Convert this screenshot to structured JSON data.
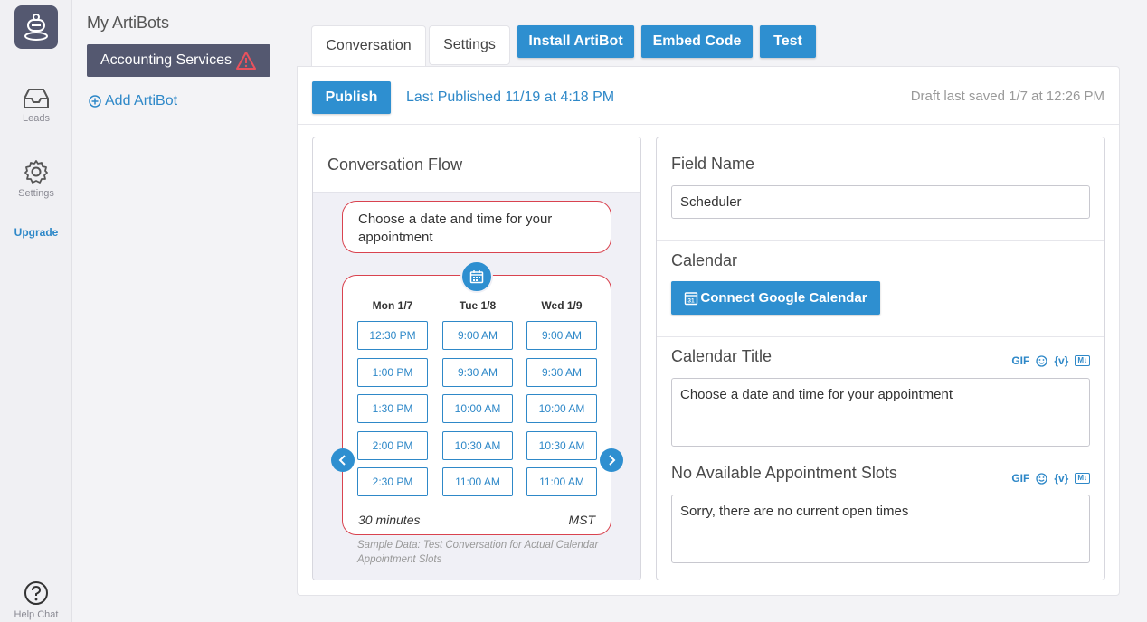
{
  "rail": {
    "leads_label": "Leads",
    "settings_label": "Settings",
    "upgrade_label": "Upgrade",
    "help_label": "Help Chat"
  },
  "bots": {
    "title": "My ArtiBots",
    "selected_bot": "Accounting Services",
    "add_label": "Add ArtiBot"
  },
  "tabs": {
    "conversation": "Conversation",
    "settings": "Settings",
    "install": "Install ArtiBot",
    "embed": "Embed Code",
    "test": "Test"
  },
  "publish_bar": {
    "publish_label": "Publish",
    "last_published": "Last Published 11/19 at 4:18 PM",
    "draft_saved": "Draft last saved 1/7 at 12:26 PM"
  },
  "flow": {
    "title": "Conversation Flow",
    "bubble_text": "Choose a date and time for your appointment",
    "columns": [
      {
        "day": "Mon 1/7",
        "slots": [
          "12:30 PM",
          "1:00 PM",
          "1:30 PM",
          "2:00 PM",
          "2:30 PM"
        ]
      },
      {
        "day": "Tue 1/8",
        "slots": [
          "9:00 AM",
          "9:30 AM",
          "10:00 AM",
          "10:30 AM",
          "11:00 AM"
        ]
      },
      {
        "day": "Wed 1/9",
        "slots": [
          "9:00 AM",
          "9:30 AM",
          "10:00 AM",
          "10:30 AM",
          "11:00 AM"
        ]
      }
    ],
    "duration": "30 minutes",
    "timezone": "MST",
    "sample_note": "Sample Data: Test Conversation for Actual Calendar Appointment Slots"
  },
  "fields": {
    "field_name_label": "Field Name",
    "field_name_value": "Scheduler",
    "calendar_label": "Calendar",
    "connect_label": "Connect Google Calendar",
    "calendar_title_label": "Calendar Title",
    "calendar_title_value": "Choose a date and time for your appointment",
    "no_slots_label": "No Available Appointment Slots",
    "no_slots_value": "Sorry, there are no current open times",
    "tool_gif": "GIF",
    "tool_var": "{v}",
    "tool_md": "M↓"
  },
  "colors": {
    "accent": "#2e8fd0",
    "warning": "#d9434f",
    "dark": "#545870"
  }
}
